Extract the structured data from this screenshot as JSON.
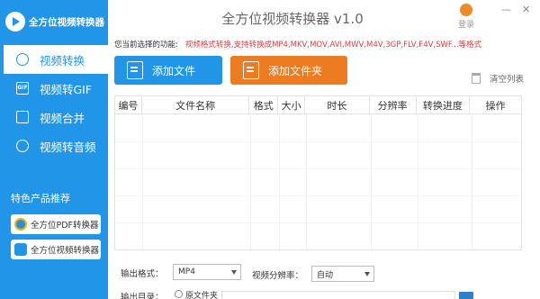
{
  "app": {
    "logo_text": "全方位视频转换器",
    "title": "全方位视频转换器 v1.0",
    "login_label": "登录"
  },
  "window": {
    "minimize": "—",
    "close": "✕"
  },
  "sidebar": {
    "items": [
      {
        "label": "视频转换",
        "icon": "convert-icon",
        "active": true
      },
      {
        "label": "视频转GIF",
        "icon": "gif-icon",
        "icon_text": "GIF"
      },
      {
        "label": "视频合并",
        "icon": "merge-icon"
      },
      {
        "label": "视频转音频",
        "icon": "audio-icon"
      }
    ],
    "promo_title": "特色产品推荐",
    "promos": [
      {
        "label": "全方位PDF转换器",
        "icon": "pdf-app-icon"
      },
      {
        "label": "全方位视频转换器",
        "icon": "video-app-icon"
      }
    ]
  },
  "hint": {
    "label": "您当前选择的功能:",
    "formats": "视频格式转换,支持转换成MP4,MKV,MOV,AVI,MWV,M4V,3GP,FLV,F4V,SWF...等格式"
  },
  "toolbar": {
    "add_file": "添加文件",
    "add_folder": "添加文件夹",
    "clear_list": "清空列表"
  },
  "table": {
    "columns": [
      "编号",
      "文件名称",
      "格式",
      "大小",
      "时长",
      "分辨率",
      "转换进度",
      "操作"
    ],
    "rows": []
  },
  "options": {
    "output_format_label": "输出格式：",
    "output_format_value": "MP4",
    "resolution_label": "视频分辨率：",
    "resolution_value": "自动",
    "output_dir_label": "输出目录：",
    "source_folder_label": "原文件夹"
  },
  "colors": {
    "sidebar": "#2196e8",
    "accent_orange": "#ec7b22",
    "hint_red": "#e23b3b"
  }
}
